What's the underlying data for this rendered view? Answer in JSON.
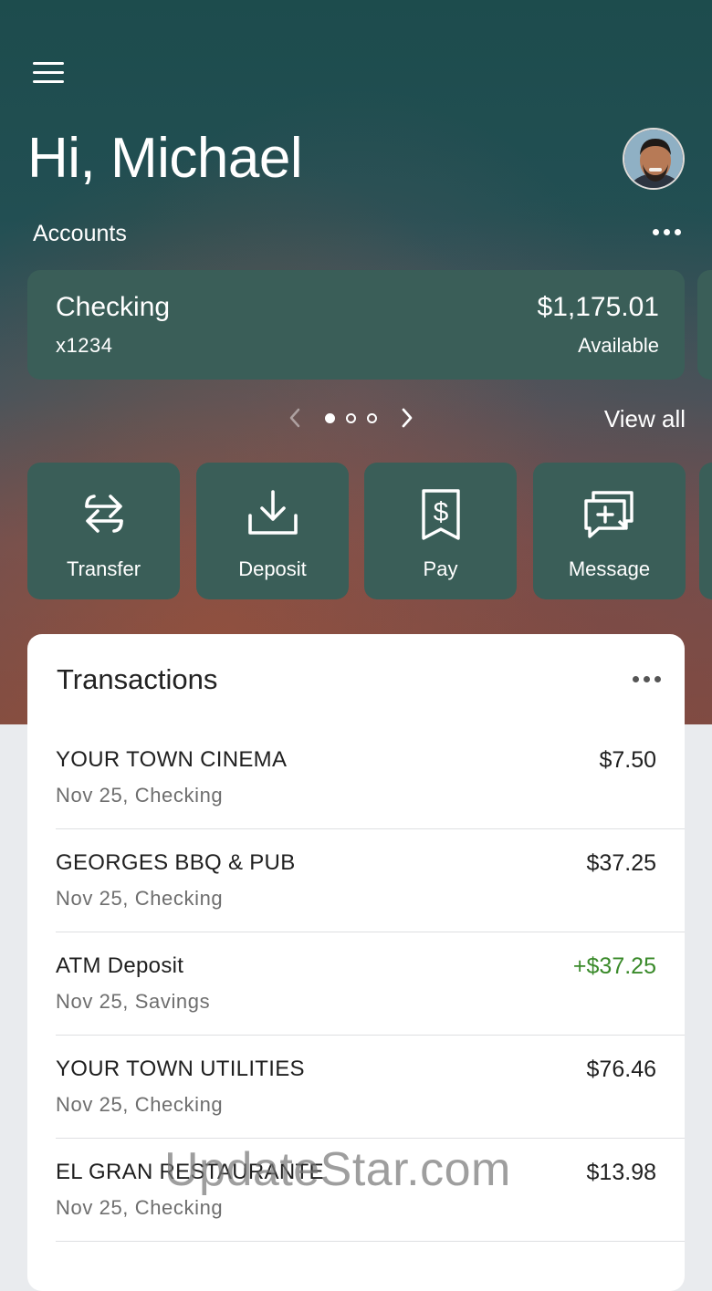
{
  "header": {
    "greeting": "Hi, Michael"
  },
  "accounts": {
    "label": "Accounts",
    "card": {
      "name": "Checking",
      "number": "x1234",
      "balance": "$1,175.01",
      "balance_label": "Available"
    },
    "pager": {
      "count": 3,
      "active_index": 0
    },
    "view_all": "View all"
  },
  "actions": [
    {
      "label": "Transfer",
      "icon": "transfer-arrows-icon"
    },
    {
      "label": "Deposit",
      "icon": "download-tray-icon"
    },
    {
      "label": "Pay",
      "icon": "dollar-receipt-icon"
    },
    {
      "label": "Message",
      "icon": "message-plus-icon"
    }
  ],
  "transactions": {
    "title": "Transactions",
    "items": [
      {
        "name": "YOUR TOWN CINEMA",
        "details": "Nov 25, Checking",
        "amount": "$7.50",
        "credit": false
      },
      {
        "name": "GEORGES BBQ & PUB",
        "details": "Nov 25, Checking",
        "amount": "$37.25",
        "credit": false
      },
      {
        "name": "ATM Deposit",
        "details": "Nov 25, Savings",
        "amount": "+$37.25",
        "credit": true
      },
      {
        "name": "YOUR TOWN UTILITIES",
        "details": "Nov 25, Checking",
        "amount": "$76.46",
        "credit": false
      },
      {
        "name": "EL GRAN RESTAURANTE",
        "details": "Nov 25, Checking",
        "amount": "$13.98",
        "credit": false
      }
    ]
  },
  "watermark": "UpdateStar.com",
  "colors": {
    "card_bg": "#3a5e58",
    "credit_green": "#3a8a2a"
  }
}
